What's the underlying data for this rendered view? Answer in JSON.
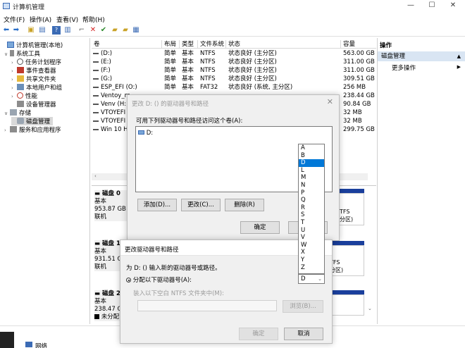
{
  "window": {
    "title": "计算机管理",
    "controls": [
      "—",
      "☐",
      "✕"
    ]
  },
  "menu": [
    "文件(F)",
    "操作(A)",
    "查看(V)",
    "帮助(H)"
  ],
  "tree": {
    "items": [
      {
        "label": "计算机管理(本地)",
        "indent": 0,
        "exp": "",
        "icon": "computer-icon"
      },
      {
        "label": "系统工具",
        "indent": 1,
        "exp": "∨",
        "icon": "tools-icon"
      },
      {
        "label": "任务计划程序",
        "indent": 2,
        "exp": "›",
        "icon": "clock-icon"
      },
      {
        "label": "事件查看器",
        "indent": 2,
        "exp": "›",
        "icon": "log-icon"
      },
      {
        "label": "共享文件夹",
        "indent": 2,
        "exp": "›",
        "icon": "folder-icon"
      },
      {
        "label": "本地用户和组",
        "indent": 2,
        "exp": "›",
        "icon": "users-icon"
      },
      {
        "label": "性能",
        "indent": 2,
        "exp": "›",
        "icon": "performance-icon"
      },
      {
        "label": "设备管理器",
        "indent": 2,
        "exp": "",
        "icon": "device-icon"
      },
      {
        "label": "存储",
        "indent": 1,
        "exp": "∨",
        "icon": "storage-icon"
      },
      {
        "label": "磁盘管理",
        "indent": 2,
        "exp": "",
        "icon": "disk-icon"
      },
      {
        "label": "服务和应用程序",
        "indent": 1,
        "exp": "›",
        "icon": "services-icon"
      }
    ]
  },
  "volumes": {
    "headers": [
      "卷",
      "布局",
      "类型",
      "文件系统",
      "状态",
      "容量"
    ],
    "rows": [
      [
        "(D:)",
        "简单",
        "基本",
        "NTFS",
        "状态良好 (主分区)",
        "563.00 GB"
      ],
      [
        "(E:)",
        "简单",
        "基本",
        "NTFS",
        "状态良好 (主分区)",
        "311.00 GB"
      ],
      [
        "(F:)",
        "简单",
        "基本",
        "NTFS",
        "状态良好 (主分区)",
        "311.00 GB"
      ],
      [
        "(G:)",
        "简单",
        "基本",
        "NTFS",
        "状态良好 (主分区)",
        "309.51 GB"
      ],
      [
        "ESP_EFI (O:)",
        "简单",
        "基本",
        "FAT32",
        "状态良好 (系统, 主分区)",
        "256 MB"
      ],
      [
        "Ventoy_m",
        "",
        "",
        "",
        "",
        "238.44 GB"
      ],
      [
        "Venv (H:)",
        "",
        "",
        "",
        "",
        "90.84 GB"
      ],
      [
        "VTOYEFI",
        "",
        "",
        "",
        "",
        "32 MB"
      ],
      [
        "VTOYEFI (",
        "",
        "",
        "",
        "",
        "32 MB"
      ],
      [
        "Win 10 Ho",
        "",
        "",
        "",
        "",
        "299.75 GB"
      ]
    ]
  },
  "disks": [
    {
      "name": "磁盘 0",
      "type": "基本",
      "size": "953.87 GB",
      "status": "联机",
      "right": [
        "TFS",
        "分区)"
      ]
    },
    {
      "name": "磁盘 1",
      "type": "基本",
      "size": "931.51 G",
      "status": "联机",
      "right": [
        "TFS",
        "分区)"
      ]
    },
    {
      "name": "磁盘 2",
      "type": "基本",
      "size": "238.47 G",
      "status": "未分配",
      "right": []
    }
  ],
  "actions": {
    "header": "操作",
    "section": "磁盘管理",
    "item": "更多操作"
  },
  "statusbar": {
    "item": "网络"
  },
  "dialog1": {
    "title": "更改 D: () 的驱动器号和路径",
    "label": "可用下列驱动器号和路径访问这个卷(A):",
    "entry": "D:",
    "buttons": {
      "add": "添加(D)...",
      "change": "更改(C)...",
      "delete": "删除(R)",
      "ok": "确定"
    }
  },
  "dialog2": {
    "title": "更改驱动器号和路径",
    "prompt": "为 D: () 输入新的驱动器号或路径。",
    "radio1": "分配以下驱动器号(A):",
    "radio2": "装入以下空白 NTFS 文件夹中(M):",
    "browse": "浏览(B)...",
    "ok": "确定",
    "cancel": "取消",
    "selected": "D"
  },
  "dropdown": {
    "options": [
      "A",
      "B",
      "D",
      "L",
      "M",
      "N",
      "P",
      "Q",
      "R",
      "S",
      "T",
      "U",
      "V",
      "W",
      "X",
      "Y",
      "Z"
    ],
    "selected": "D"
  },
  "colors": {
    "accent": "#0078d7",
    "disk_bar": "#1a3f9c"
  }
}
